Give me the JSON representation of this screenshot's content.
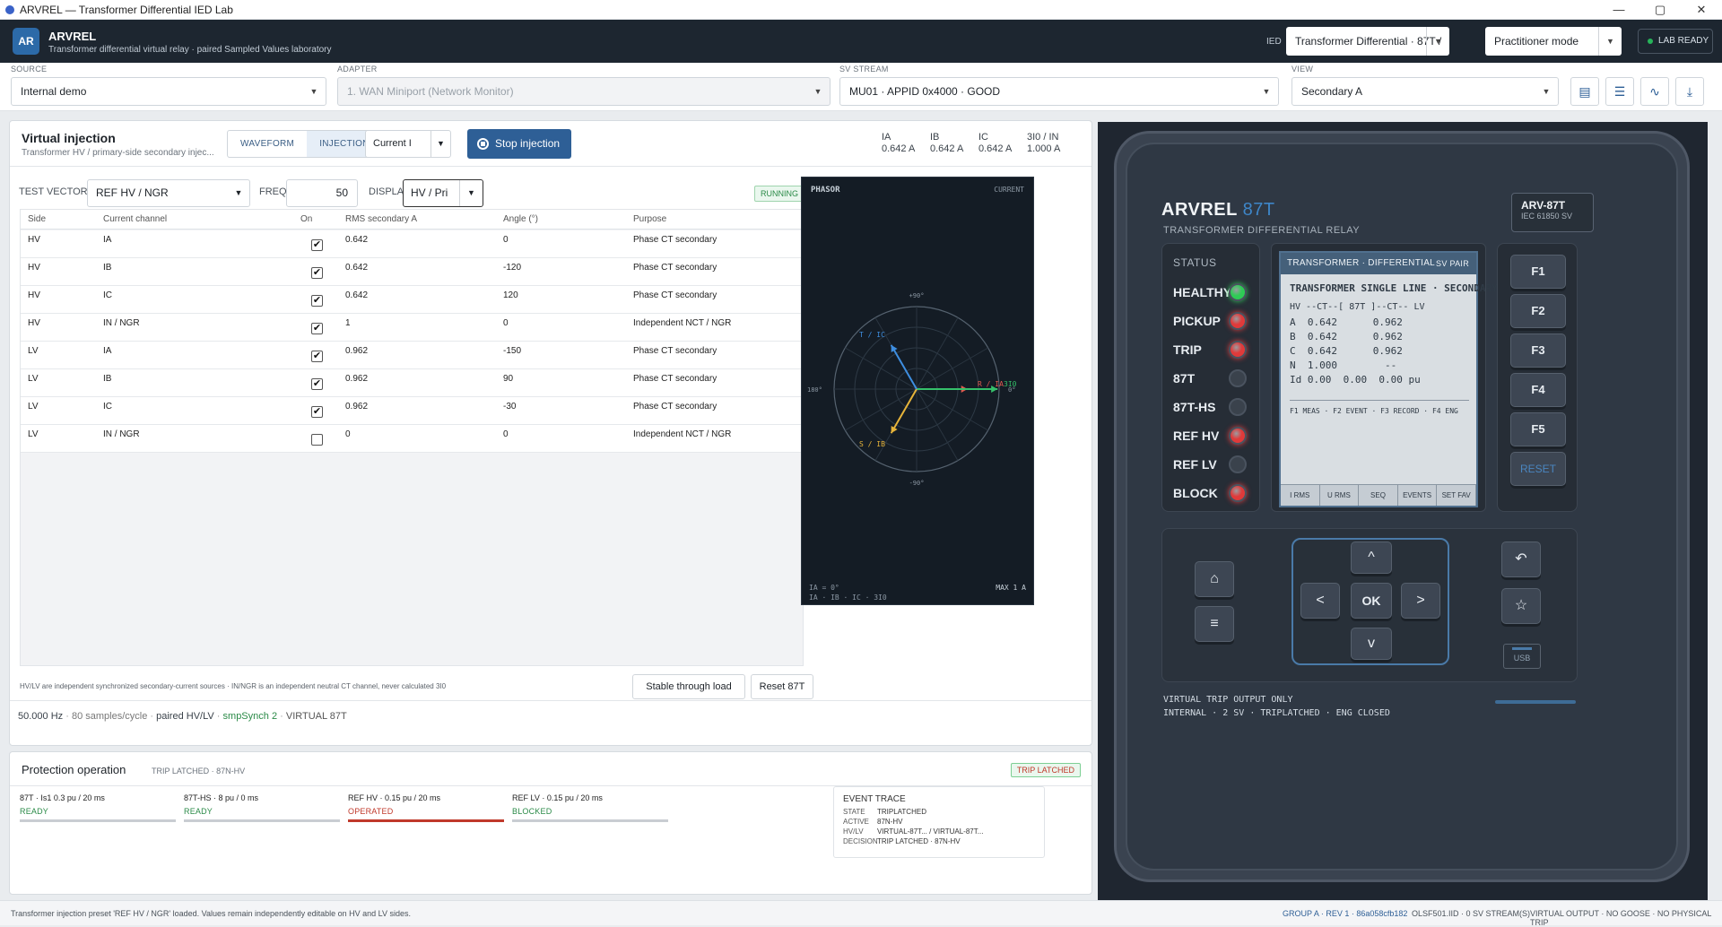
{
  "window": {
    "title": "ARVREL — Transformer Differential IED Lab",
    "min": "—",
    "max": "▢",
    "close": "✕"
  },
  "app": {
    "logo": "AR",
    "name": "ARVREL",
    "subtitle": "Transformer differential virtual relay · paired Sampled Values laboratory",
    "ied_label": "IED",
    "ied_value": "Transformer Differential · 87T /",
    "mode_value": "Practitioner mode",
    "lab_status": "LAB READY"
  },
  "toolbar": {
    "source_label": "SOURCE",
    "source_value": "Internal demo",
    "adapter_label": "ADAPTER",
    "adapter_value": "1. WAN Miniport (Network Monitor)",
    "stream_label": "SV STREAM",
    "stream_value": "MU01 · APPID 0x4000 · GOOD",
    "view_label": "VIEW",
    "view_value": "Secondary A"
  },
  "injection": {
    "title": "Virtual injection",
    "subtitle": "Transformer HV / primary-side secondary injec...",
    "tabs": [
      {
        "label": "WAVEFORM",
        "active": false
      },
      {
        "label": "INJECTION",
        "active": true
      }
    ],
    "quantity": "Current I",
    "stop_label": "Stop injection",
    "meas": [
      {
        "k": "IA",
        "v": "0.642 A"
      },
      {
        "k": "IB",
        "v": "0.642 A"
      },
      {
        "k": "IC",
        "v": "0.642 A"
      },
      {
        "k": "3I0 / IN",
        "v": "1.000 A"
      }
    ],
    "test_vector_label": "TEST VECTOR",
    "test_vector": "REF HV / NGR",
    "freq_label": "FREQ",
    "freq": "50",
    "display_label": "DISPLAY",
    "display": "HV / Pri",
    "status": "RUNNING",
    "columns": [
      "Side",
      "Current channel",
      "On",
      "RMS secondary A",
      "Angle (°)",
      "Purpose"
    ],
    "rows": [
      {
        "side": "HV",
        "ch": "IA",
        "on": true,
        "rms": "0.642",
        "ang": "0",
        "purpose": "Phase CT secondary"
      },
      {
        "side": "HV",
        "ch": "IB",
        "on": true,
        "rms": "0.642",
        "ang": "-120",
        "purpose": "Phase CT secondary"
      },
      {
        "side": "HV",
        "ch": "IC",
        "on": true,
        "rms": "0.642",
        "ang": "120",
        "purpose": "Phase CT secondary"
      },
      {
        "side": "HV",
        "ch": "IN / NGR",
        "on": true,
        "rms": "1",
        "ang": "0",
        "purpose": "Independent NCT / NGR"
      },
      {
        "side": "LV",
        "ch": "IA",
        "on": true,
        "rms": "0.962",
        "ang": "-150",
        "purpose": "Phase CT secondary"
      },
      {
        "side": "LV",
        "ch": "IB",
        "on": true,
        "rms": "0.962",
        "ang": "90",
        "purpose": "Phase CT secondary"
      },
      {
        "side": "LV",
        "ch": "IC",
        "on": true,
        "rms": "0.962",
        "ang": "-30",
        "purpose": "Phase CT secondary"
      },
      {
        "side": "LV",
        "ch": "IN / NGR",
        "on": false,
        "rms": "0",
        "ang": "0",
        "purpose": "Independent NCT / NGR"
      }
    ],
    "note": "HV/LV are independent synchronized secondary-current sources · IN/NGR is an independent neutral CT channel, never calculated 3I0",
    "btn_stable": "Stable through load",
    "btn_reset": "Reset 87T",
    "footer": {
      "hz": "50.000 Hz",
      "spc": "80 samples/cycle",
      "pair": "paired HV/LV",
      "sync": "smpSynch 2",
      "virt": "VIRTUAL 87T",
      "sep": "·"
    }
  },
  "phasor": {
    "title": "PHASOR",
    "mode": "CURRENT",
    "deg90": "+90°",
    "deg180": "180°",
    "degm90": "-90°",
    "deg0": "0°",
    "lbl_r": "R / IA",
    "lbl_3i0": "3I0",
    "lbl_t": "T / IC",
    "lbl_s": "S / IB",
    "ref": "IA = 0°",
    "chans": "IA · IB · IC · 3I0",
    "max": "MAX 1 A",
    "vectors": [
      {
        "name": "IA",
        "angle": 0,
        "mag": 0.642,
        "color": "#e05a4f"
      },
      {
        "name": "3I0",
        "angle": 0,
        "mag": 1.0,
        "color": "#35c06a"
      },
      {
        "name": "IB",
        "angle": -120,
        "mag": 0.642,
        "color": "#e7b43a"
      },
      {
        "name": "IC",
        "angle": 120,
        "mag": 0.642,
        "color": "#3e8ee0"
      }
    ]
  },
  "protection": {
    "title": "Protection operation",
    "state": "TRIP LATCHED · 87N-HV",
    "badge": "TRIP LATCHED",
    "stages": [
      {
        "name": "87T · Is1 0.3 pu / 20 ms",
        "status": "READY",
        "color": "#2a8a47"
      },
      {
        "name": "87T-HS · 8 pu / 0 ms",
        "status": "READY",
        "color": "#2a8a47"
      },
      {
        "name": "REF HV · 0.15 pu / 20 ms",
        "status": "OPERATED",
        "color": "#c0392b"
      },
      {
        "name": "REF LV · 0.15 pu / 20 ms",
        "status": "BLOCKED",
        "color": "#2a8a47"
      }
    ],
    "trace": {
      "title": "EVENT TRACE",
      "lines": [
        {
          "k": "STATE",
          "v": "TRIPLATCHED"
        },
        {
          "k": "ACTIVE",
          "v": "87N-HV"
        },
        {
          "k": "HV/LV",
          "v": "VIRTUAL-87T... / VIRTUAL-87T..."
        },
        {
          "k": "DECISION",
          "v": "TRIP LATCHED · 87N-HV"
        }
      ]
    }
  },
  "relay": {
    "brand": "ARVREL",
    "model_suffix": "87T",
    "subtitle": "TRANSFORMER DIFFERENTIAL RELAY",
    "model": "ARV-87T",
    "standard": "IEC 61850 SV",
    "status_title": "STATUS",
    "leds": [
      {
        "name": "HEALTHY",
        "color": "#2ecc55"
      },
      {
        "name": "PICKUP",
        "color": "#e03a3a"
      },
      {
        "name": "TRIP",
        "color": "#e03a3a"
      },
      {
        "name": "87T",
        "color": "#3a424c"
      },
      {
        "name": "87T-HS",
        "color": "#3a424c"
      },
      {
        "name": "REF HV",
        "color": "#e03a3a"
      },
      {
        "name": "REF LV",
        "color": "#3a424c"
      },
      {
        "name": "BLOCK",
        "color": "#e03a3a"
      }
    ],
    "lcd": {
      "header": "TRANSFORMER · DIFFERENTIAL",
      "header_right": "SV PAIR",
      "title": "TRANSFORMER SINGLE LINE · SECONDARY",
      "lines": [
        "HV --CT--[ 87T ]--CT-- LV",
        "A  0.642      0.962",
        "B  0.642      0.962",
        "C  0.642      0.962",
        "N  1.000        --",
        "Id 0.00  0.00  0.00 pu"
      ],
      "fkeys_help": "F1 MEAS · F2 EVENT · F3 RECORD · F4 ENG",
      "softkeys": [
        "I RMS",
        "U RMS",
        "SEQ",
        "EVENTS",
        "SET FAV"
      ]
    },
    "fkeys": [
      "F1",
      "F2",
      "F3",
      "F4",
      "F5",
      "RESET"
    ],
    "nav": {
      "home": "⌂",
      "menu": "≡",
      "up": "^",
      "down": "v",
      "left": "<",
      "right": ">",
      "ok": "OK",
      "back": "↶",
      "fav": "☆",
      "usb": "USB"
    },
    "footer1": "VIRTUAL TRIP OUTPUT ONLY",
    "footer2": "INTERNAL · 2 SV · TRIPLATCHED · ENG CLOSED"
  },
  "statusbar": {
    "left": "Transformer injection preset 'REF HV / NGR' loaded. Values remain independently editable on HV and LV sides.",
    "group": "GROUP A · REV 1 · 86a058cfb182",
    "file": "OLSF501.IID · 0 SV STREAM(S)",
    "virt": "VIRTUAL OUTPUT · NO GOOSE · NO PHYSICAL TRIP"
  },
  "colors": {
    "accent": "#2e5f96",
    "header": "#1d2630",
    "trip": "#c0392b",
    "ok": "#2a8a47"
  }
}
